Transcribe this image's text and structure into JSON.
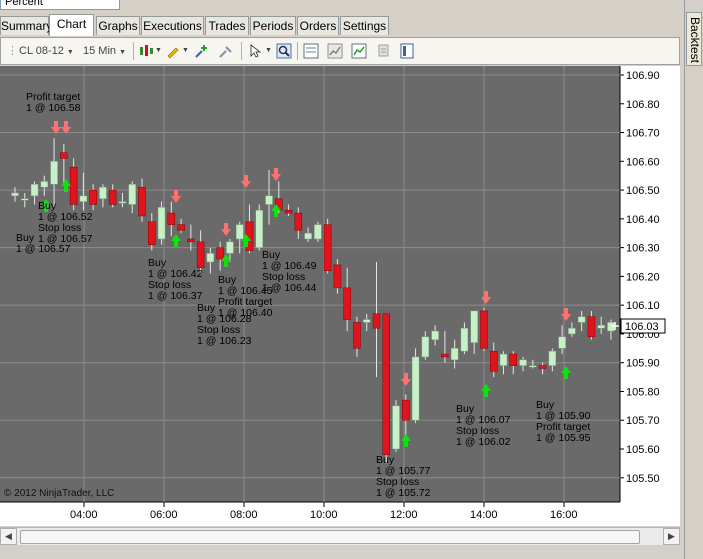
{
  "top_field": {
    "value": "Percent"
  },
  "tabs": [
    {
      "label": "Summary"
    },
    {
      "label": "Chart",
      "active": true
    },
    {
      "label": "Graphs"
    },
    {
      "label": "Executions"
    },
    {
      "label": "Trades"
    },
    {
      "label": "Periods"
    },
    {
      "label": "Orders"
    },
    {
      "label": "Settings"
    }
  ],
  "toolbar": {
    "instrument": "CL 08-12",
    "interval": "15 Min"
  },
  "side_tab": {
    "label": "Backtest"
  },
  "copyright": "© 2012 NinjaTrader, LLC",
  "colors": {
    "chart_bg": "#6a6a6a",
    "up_candle": "#c8f0c8",
    "down_candle": "#e0141c",
    "entry_arrow": "#10e010",
    "exit_arrow": "#ff7070",
    "grid": "#8c8c8c"
  },
  "chart_data": {
    "type": "candlestick",
    "ylim": [
      105.45,
      106.92
    ],
    "yticks": [
      "106.90",
      "106.80",
      "106.70",
      "106.60",
      "106.50",
      "106.40",
      "106.30",
      "106.20",
      "106.10",
      "106.00",
      "105.90",
      "105.80",
      "105.70",
      "105.60",
      "105.50"
    ],
    "xticks": [
      "04:00",
      "06:00",
      "08:00",
      "10:00",
      "12:00",
      "14:00",
      "16:00"
    ],
    "last_price": "106.03",
    "candles": [
      {
        "o": 106.48,
        "h": 106.51,
        "l": 106.46,
        "c": 106.49
      },
      {
        "o": 106.47,
        "h": 106.49,
        "l": 106.44,
        "c": 106.47
      },
      {
        "o": 106.48,
        "h": 106.53,
        "l": 106.45,
        "c": 106.52
      },
      {
        "o": 106.51,
        "h": 106.55,
        "l": 106.48,
        "c": 106.53
      },
      {
        "o": 106.52,
        "h": 106.68,
        "l": 106.44,
        "c": 106.6
      },
      {
        "o": 106.63,
        "h": 106.66,
        "l": 106.52,
        "c": 106.61
      },
      {
        "o": 106.58,
        "h": 106.61,
        "l": 106.43,
        "c": 106.45
      },
      {
        "o": 106.46,
        "h": 106.56,
        "l": 106.43,
        "c": 106.48
      },
      {
        "o": 106.5,
        "h": 106.52,
        "l": 106.43,
        "c": 106.45
      },
      {
        "o": 106.47,
        "h": 106.52,
        "l": 106.44,
        "c": 106.51
      },
      {
        "o": 106.5,
        "h": 106.52,
        "l": 106.44,
        "c": 106.45
      },
      {
        "o": 106.46,
        "h": 106.49,
        "l": 106.44,
        "c": 106.46
      },
      {
        "o": 106.45,
        "h": 106.53,
        "l": 106.42,
        "c": 106.52
      },
      {
        "o": 106.51,
        "h": 106.54,
        "l": 106.39,
        "c": 106.41
      },
      {
        "o": 106.39,
        "h": 106.42,
        "l": 106.29,
        "c": 106.31
      },
      {
        "o": 106.33,
        "h": 106.46,
        "l": 106.31,
        "c": 106.44
      },
      {
        "o": 106.42,
        "h": 106.46,
        "l": 106.34,
        "c": 106.38
      },
      {
        "o": 106.38,
        "h": 106.4,
        "l": 106.35,
        "c": 106.36
      },
      {
        "o": 106.33,
        "h": 106.38,
        "l": 106.29,
        "c": 106.32
      },
      {
        "o": 106.32,
        "h": 106.36,
        "l": 106.21,
        "c": 106.23
      },
      {
        "o": 106.25,
        "h": 106.3,
        "l": 106.21,
        "c": 106.28
      },
      {
        "o": 106.3,
        "h": 106.32,
        "l": 106.22,
        "c": 106.26
      },
      {
        "o": 106.28,
        "h": 106.33,
        "l": 106.25,
        "c": 106.32
      },
      {
        "o": 106.33,
        "h": 106.39,
        "l": 106.28,
        "c": 106.38
      },
      {
        "o": 106.39,
        "h": 106.45,
        "l": 106.28,
        "c": 106.29
      },
      {
        "o": 106.3,
        "h": 106.45,
        "l": 106.29,
        "c": 106.43
      },
      {
        "o": 106.45,
        "h": 106.57,
        "l": 106.38,
        "c": 106.48
      },
      {
        "o": 106.47,
        "h": 106.53,
        "l": 106.42,
        "c": 106.43
      },
      {
        "o": 106.43,
        "h": 106.45,
        "l": 106.41,
        "c": 106.42
      },
      {
        "o": 106.42,
        "h": 106.44,
        "l": 106.33,
        "c": 106.36
      },
      {
        "o": 106.33,
        "h": 106.37,
        "l": 106.32,
        "c": 106.35
      },
      {
        "o": 106.33,
        "h": 106.39,
        "l": 106.32,
        "c": 106.38
      },
      {
        "o": 106.38,
        "h": 106.4,
        "l": 106.21,
        "c": 106.22
      },
      {
        "o": 106.24,
        "h": 106.26,
        "l": 106.14,
        "c": 106.16
      },
      {
        "o": 106.16,
        "h": 106.23,
        "l": 106.01,
        "c": 106.05
      },
      {
        "o": 106.04,
        "h": 106.06,
        "l": 105.92,
        "c": 105.95
      },
      {
        "o": 106.04,
        "h": 106.07,
        "l": 106.01,
        "c": 106.05
      },
      {
        "o": 106.07,
        "h": 106.25,
        "l": 105.85,
        "c": 106.02
      },
      {
        "o": 106.07,
        "h": 106.07,
        "l": 105.55,
        "c": 105.58
      },
      {
        "o": 105.6,
        "h": 105.77,
        "l": 105.59,
        "c": 105.75
      },
      {
        "o": 105.77,
        "h": 105.79,
        "l": 105.62,
        "c": 105.7
      },
      {
        "o": 105.7,
        "h": 105.95,
        "l": 105.69,
        "c": 105.92
      },
      {
        "o": 105.92,
        "h": 106.01,
        "l": 105.91,
        "c": 105.99
      },
      {
        "o": 105.98,
        "h": 106.03,
        "l": 105.96,
        "c": 106.01
      },
      {
        "o": 105.93,
        "h": 106.01,
        "l": 105.9,
        "c": 105.92
      },
      {
        "o": 105.91,
        "h": 105.98,
        "l": 105.88,
        "c": 105.95
      },
      {
        "o": 105.94,
        "h": 106.04,
        "l": 105.93,
        "c": 106.02
      },
      {
        "o": 105.97,
        "h": 106.08,
        "l": 105.93,
        "c": 106.08
      },
      {
        "o": 106.08,
        "h": 106.09,
        "l": 105.94,
        "c": 105.95
      },
      {
        "o": 105.94,
        "h": 105.97,
        "l": 105.85,
        "c": 105.87
      },
      {
        "o": 105.89,
        "h": 105.94,
        "l": 105.86,
        "c": 105.93
      },
      {
        "o": 105.93,
        "h": 105.94,
        "l": 105.86,
        "c": 105.89
      },
      {
        "o": 105.89,
        "h": 105.92,
        "l": 105.87,
        "c": 105.91
      },
      {
        "o": 105.89,
        "h": 105.91,
        "l": 105.88,
        "c": 105.89
      },
      {
        "o": 105.89,
        "h": 105.9,
        "l": 105.86,
        "c": 105.88
      },
      {
        "o": 105.89,
        "h": 105.95,
        "l": 105.87,
        "c": 105.94
      },
      {
        "o": 105.95,
        "h": 106.03,
        "l": 105.93,
        "c": 105.99
      },
      {
        "o": 106.0,
        "h": 106.04,
        "l": 105.99,
        "c": 106.02
      },
      {
        "o": 106.04,
        "h": 106.08,
        "l": 106.01,
        "c": 106.06
      },
      {
        "o": 106.06,
        "h": 106.08,
        "l": 105.98,
        "c": 105.99
      },
      {
        "o": 106.02,
        "h": 106.06,
        "l": 106.0,
        "c": 106.03
      },
      {
        "o": 106.01,
        "h": 106.05,
        "l": 105.98,
        "c": 106.04
      }
    ],
    "annotations": [
      {
        "lines": [
          "Profit target",
          "1 @ 106.58"
        ]
      },
      {
        "lines": [
          "Buy",
          "1 @ 106.57"
        ]
      },
      {
        "lines": [
          "Buy",
          "1 @ 106.52",
          "Stop loss",
          "1 @ 106.57"
        ]
      },
      {
        "lines": [
          "Buy",
          "1 @ 106.42",
          "Stop loss",
          "1 @ 106.37"
        ]
      },
      {
        "lines": [
          "Buy",
          "1 @ 106.28",
          "Stop loss",
          "1 @ 106.23"
        ]
      },
      {
        "lines": [
          "Buy",
          "1 @ 106.45",
          "Profit target",
          "1 @ 106.40"
        ]
      },
      {
        "lines": [
          "Buy",
          "1 @ 106.49",
          "Stop loss",
          "1 @ 106.44"
        ]
      },
      {
        "lines": [
          "Buy",
          "1 @ 105.77",
          "Stop loss",
          "1 @ 105.72"
        ]
      },
      {
        "lines": [
          "Buy",
          "1 @ 106.07",
          "Stop loss",
          "1 @ 106.02"
        ]
      },
      {
        "lines": [
          "Buy",
          "1 @ 105.90",
          "Profit target",
          "1 @ 105.95"
        ]
      }
    ]
  }
}
